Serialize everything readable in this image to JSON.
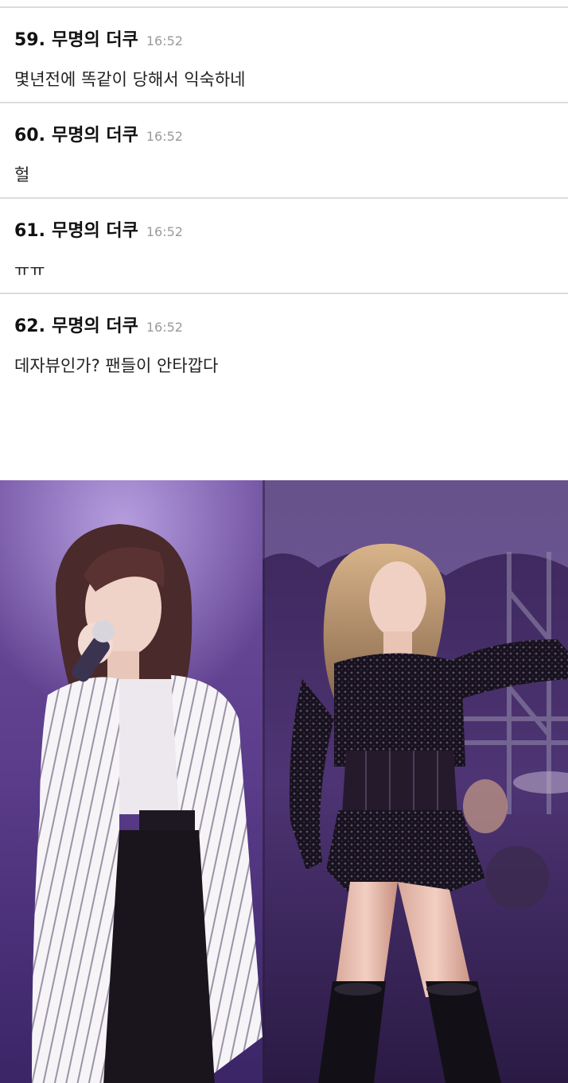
{
  "comments": [
    {
      "number": "59.",
      "author": "무명의 더쿠",
      "time": "16:52",
      "text": "몇년전에 똑같이 당해서 익숙하네"
    },
    {
      "number": "60.",
      "author": "무명의 더쿠",
      "time": "16:52",
      "text": "헐"
    },
    {
      "number": "61.",
      "author": "무명의 더쿠",
      "time": "16:52",
      "text": "ㅠㅠ"
    },
    {
      "number": "62.",
      "author": "무명의 더쿠",
      "time": "16:52",
      "text": "데자뷰인가? 팬들이 안타깝다"
    }
  ],
  "photo": {
    "left_subject": "singer-in-white-striped-shirt",
    "right_subject": "performer-in-black-sequin-outfit"
  }
}
